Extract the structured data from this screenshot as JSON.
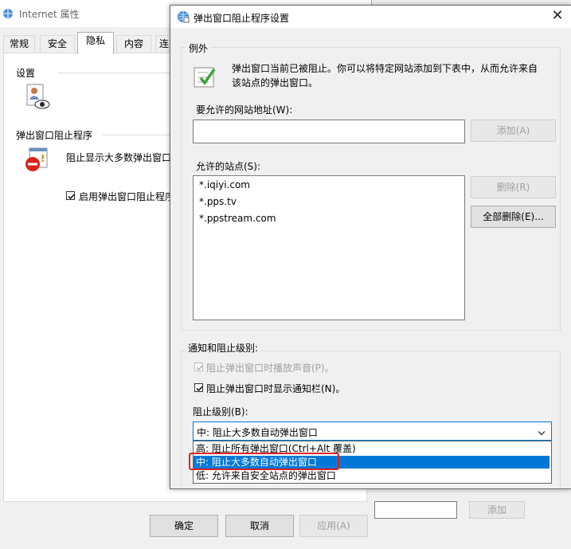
{
  "background_window": {
    "title": "Internet 属性",
    "tabs": [
      "常规",
      "安全",
      "隐私",
      "内容",
      "连"
    ],
    "active_tab": "隐私",
    "settings_title": "设置",
    "popup_title": "弹出窗口阻止程序",
    "popup_desc": "阻止显示大多数弹出窗口",
    "enable_checkbox": "启用弹出窗口阻止程序",
    "ok_button": "确定",
    "cancel_button": "取消",
    "apply_button": "应用(A)"
  },
  "right_window": {
    "add_button": "添加"
  },
  "dialog": {
    "title": "弹出窗口阻止程序设置",
    "close_symbol": "✕",
    "exceptions": {
      "label": "例外",
      "description_line1": "弹出窗口当前已被阻止。你可以将特定网站添加到下表中，从而允许来自",
      "description_line2": "该站点的弹出窗口。",
      "address_label": "要允许的网站地址(W):",
      "address_value": "",
      "add_button": "添加(A)",
      "allowed_label": "允许的站点(S):",
      "allowed_sites": [
        "*.iqiyi.com",
        "*.pps.tv",
        "*.ppstream.com"
      ],
      "remove_button": "删除(R)",
      "remove_all_button": "全部删除(E)..."
    },
    "notification": {
      "label": "通知和阻止级别:",
      "sound_checkbox": "阻止弹出窗口时播放声音(P)。",
      "notify_bar_checkbox": "阻止弹出窗口时显示通知栏(N)。",
      "level_label": "阻止级别(B):",
      "level_selected": "中: 阻止大多数自动弹出窗口",
      "level_options": [
        "高: 阻止所有弹出窗口(Ctrl+Alt 覆盖)",
        "中: 阻止大多数自动弹出窗口",
        "低: 允许来自安全站点的弹出窗口"
      ]
    },
    "colors": {
      "highlight": "#0078d7",
      "annotation_box": "#e02020"
    }
  }
}
